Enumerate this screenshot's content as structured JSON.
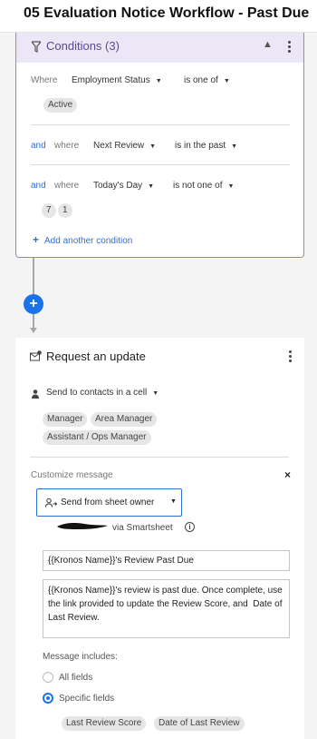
{
  "header": {
    "title": "05 Evaluation Notice Workflow - Past Due"
  },
  "conditions": {
    "title": "Conditions (3)",
    "rows": [
      {
        "connector": "Where",
        "field": "Employment Status",
        "operator": "is one of",
        "values": [
          "Active"
        ]
      },
      {
        "connector": "and",
        "connector2": "where",
        "field": "Next Review",
        "operator": "is in the past",
        "values": []
      },
      {
        "connector": "and",
        "connector2": "where",
        "field": "Today's Day",
        "operator": "is not one of",
        "values": [
          "7",
          "1"
        ]
      }
    ],
    "add_label": "Add another condition"
  },
  "connector_plus": "+",
  "request": {
    "title": "Request an update",
    "send_to": "Send to contacts in a cell",
    "recipients": [
      "Manager",
      "Area Manager",
      "Assistant / Ops Manager"
    ],
    "customize_label": "Customize message",
    "close_icon": "×",
    "sender": "Send from sheet owner",
    "via": "via Smartsheet",
    "info_icon": "i",
    "subject": "{{Kronos Name}}'s Review Past Due",
    "body": "{{Kronos Name}}'s review is past due. Once complete, use the link provided to update the Review Score, and  Date of Last Review.",
    "includes_label": "Message includes:",
    "options": [
      {
        "label": "All fields",
        "selected": false
      },
      {
        "label": "Specific fields",
        "selected": true
      }
    ],
    "fields": [
      "Last Review Score",
      "Date of Last Review"
    ]
  },
  "colors": {
    "accent": "#1a73e8",
    "conditions_border": "#9b82cf",
    "conditions_header": "#ece7f6"
  },
  "icons": [
    "funnel-icon",
    "chevron-up-icon",
    "kebab-icon",
    "plus-icon",
    "request-update-icon",
    "person-icon",
    "close-icon",
    "sender-icon",
    "info-icon"
  ]
}
